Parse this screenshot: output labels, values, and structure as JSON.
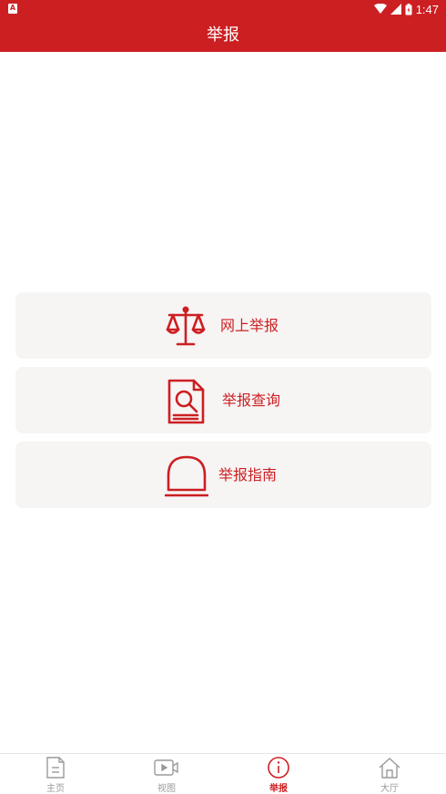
{
  "status_bar": {
    "time": "1:47",
    "icons": [
      "notification-a-icon",
      "wifi-icon",
      "signal-icon",
      "battery-icon"
    ]
  },
  "header": {
    "title": "举报"
  },
  "menu": {
    "items": [
      {
        "label": "网上举报",
        "icon": "scales-icon"
      },
      {
        "label": "举报查询",
        "icon": "document-search-icon"
      },
      {
        "label": "举报指南",
        "icon": "siren-icon"
      }
    ]
  },
  "bottom_nav": {
    "items": [
      {
        "label": "主页",
        "icon": "home-document-icon",
        "active": false
      },
      {
        "label": "视图",
        "icon": "video-icon",
        "active": false
      },
      {
        "label": "举报",
        "icon": "info-icon",
        "active": true
      },
      {
        "label": "大厅",
        "icon": "house-icon",
        "active": false
      }
    ]
  },
  "colors": {
    "primary": "#cc1f22",
    "card_bg": "#f7f4f4",
    "nav_inactive": "#9a9a9a"
  }
}
